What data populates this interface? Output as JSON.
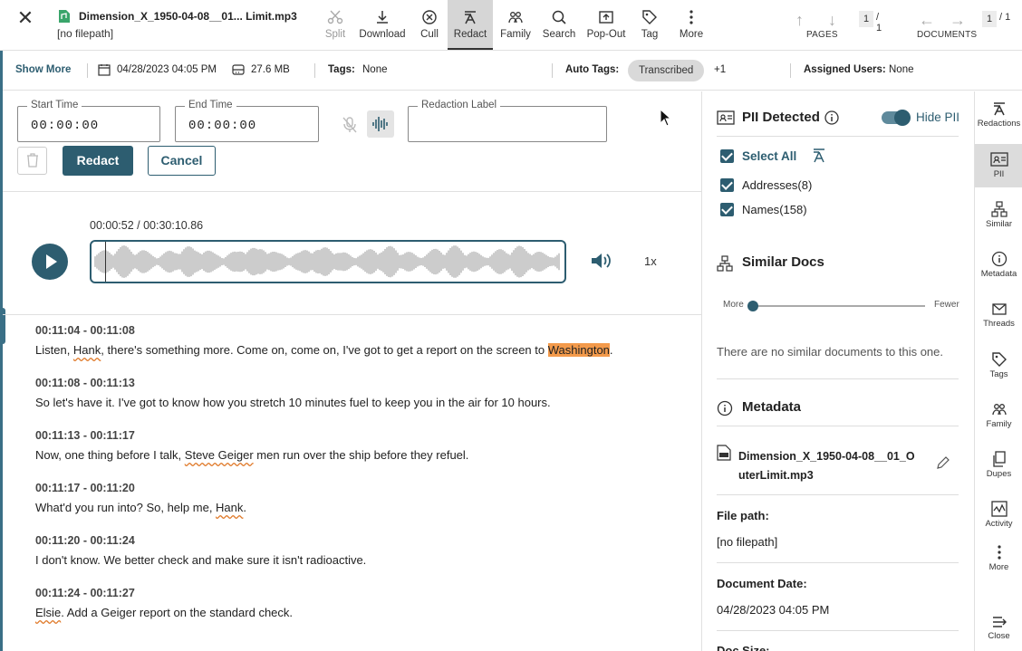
{
  "header": {
    "file_name": "Dimension_X_1950-04-08__01... Limit.mp3",
    "file_path": "[no filepath]",
    "tools": [
      {
        "label": "Split"
      },
      {
        "label": "Download"
      },
      {
        "label": "Cull"
      },
      {
        "label": "Redact"
      },
      {
        "label": "Family"
      },
      {
        "label": "Search"
      },
      {
        "label": "Pop-Out"
      },
      {
        "label": "Tag"
      },
      {
        "label": "More"
      }
    ],
    "pages": {
      "current": "1",
      "total": "/ 1",
      "label": "PAGES"
    },
    "documents": {
      "current": "1",
      "total": "/ 1",
      "label": "DOCUMENTS"
    }
  },
  "infobar": {
    "show_more": "Show More",
    "date": "04/28/2023 04:05 PM",
    "size": "27.6 MB",
    "tags_label": "Tags:",
    "tags_value": "None",
    "auto_tags_label": "Auto Tags:",
    "auto_tag_chip": "Transcribed",
    "auto_tag_more": "+1",
    "assigned_label": "Assigned Users:",
    "assigned_value": "None"
  },
  "redact_form": {
    "start_label": "Start Time",
    "start_value": "00:00:00",
    "end_label": "End Time",
    "end_value": "00:00:00",
    "label_label": "Redaction Label",
    "label_value": "",
    "redact_btn": "Redact",
    "cancel_btn": "Cancel"
  },
  "player": {
    "time": "00:00:52 / 00:30:10.86",
    "speed": "1x"
  },
  "transcript": [
    {
      "ts": "00:11:04 - 00:11:08",
      "parts": [
        {
          "t": "Listen, "
        },
        {
          "t": "Hank",
          "pii": true
        },
        {
          "t": ", there's something more. Come on, come on, I've got to get a report on the screen to "
        },
        {
          "t": "Washington",
          "hl": true
        },
        {
          "t": "."
        }
      ]
    },
    {
      "ts": "00:11:08 - 00:11:13",
      "parts": [
        {
          "t": "So let's have it. I've got to know how you stretch 10 minutes fuel to keep you in the air for 10 hours."
        }
      ]
    },
    {
      "ts": "00:11:13 - 00:11:17",
      "parts": [
        {
          "t": "Now, one thing before I talk, "
        },
        {
          "t": "Steve Geiger",
          "pii": true
        },
        {
          "t": " men run over the ship before they refuel."
        }
      ]
    },
    {
      "ts": "00:11:17 - 00:11:20",
      "parts": [
        {
          "t": "What'd you run into? So, help me, "
        },
        {
          "t": "Hank",
          "pii": true
        },
        {
          "t": "."
        }
      ]
    },
    {
      "ts": "00:11:20 - 00:11:24",
      "parts": [
        {
          "t": "I don't know. We better check and make sure it isn't radioactive."
        }
      ]
    },
    {
      "ts": "00:11:24 - 00:11:27",
      "parts": [
        {
          "t": "Elsie",
          "pii": true
        },
        {
          "t": ". Add a Geiger report on the standard check."
        }
      ]
    }
  ],
  "pii_panel": {
    "title": "PII Detected",
    "hide_label": "Hide PII",
    "select_all": "Select All",
    "items": [
      {
        "label": "Addresses",
        "count": "(8)"
      },
      {
        "label": "Names",
        "count": "(158)"
      }
    ]
  },
  "similar_panel": {
    "title": "Similar Docs",
    "more": "More",
    "fewer": "Fewer",
    "empty": "There are no similar documents to this one."
  },
  "metadata_panel": {
    "title": "Metadata",
    "file_name_line1": "Dimension_X_1950-04-08__01_O",
    "file_name_line2": "uterLimit.mp3",
    "file_path_label": "File path:",
    "file_path_value": "[no filepath]",
    "doc_date_label": "Document Date:",
    "doc_date_value": "04/28/2023 04:05 PM",
    "doc_size_label": "Doc Size:"
  },
  "rail": [
    {
      "label": "Redactions"
    },
    {
      "label": "PII"
    },
    {
      "label": "Similar"
    },
    {
      "label": "Metadata"
    },
    {
      "label": "Threads"
    },
    {
      "label": "Tags"
    },
    {
      "label": "Family"
    },
    {
      "label": "Dupes"
    },
    {
      "label": "Activity"
    },
    {
      "label": "More"
    },
    {
      "label": "Close"
    }
  ],
  "colors": {
    "primary": "#2d5d70",
    "highlight": "#f39a4b",
    "pii_underline": "#e07a2a"
  },
  "waveform": {
    "playhead_fraction": 0.029
  }
}
